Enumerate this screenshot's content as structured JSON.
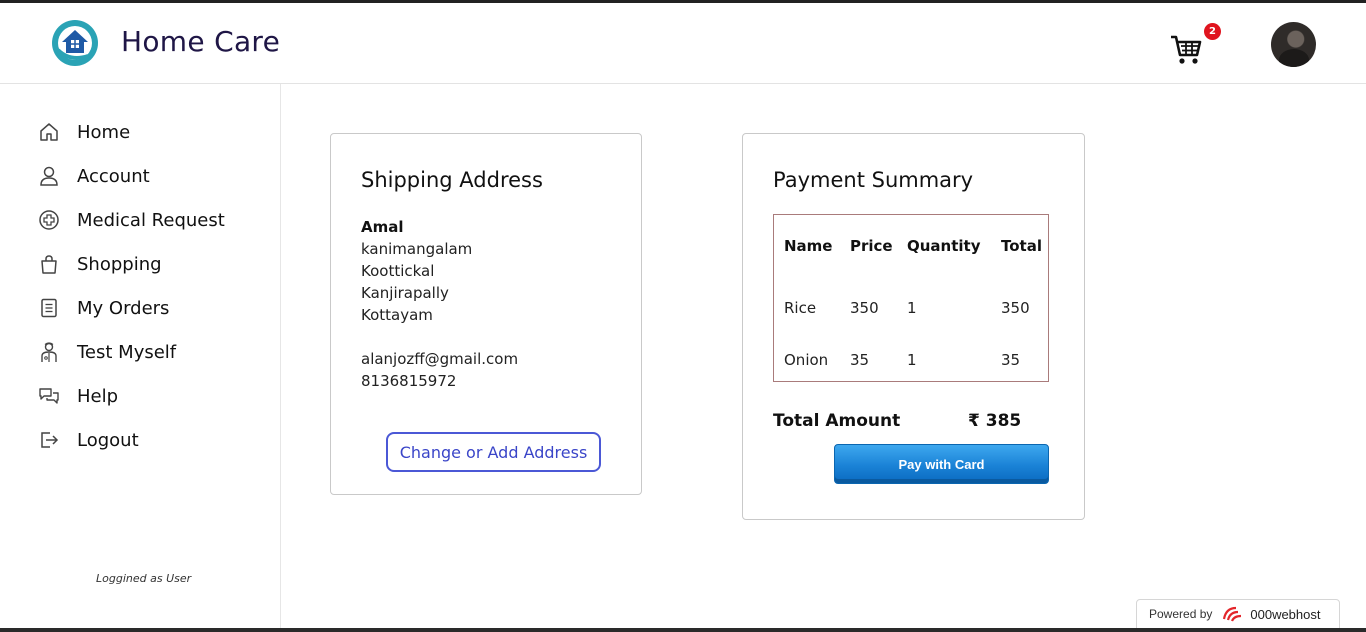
{
  "header": {
    "brand": "Home Care",
    "cart_count": "2",
    "logo_icon": "home-hand-logo-icon",
    "cart_icon": "cart-icon"
  },
  "sidebar": {
    "items": [
      {
        "label": "Home",
        "icon": "home-icon"
      },
      {
        "label": "Account",
        "icon": "user-icon"
      },
      {
        "label": "Medical Request",
        "icon": "medical-cross-icon"
      },
      {
        "label": "Shopping",
        "icon": "shopping-bag-icon"
      },
      {
        "label": "My Orders",
        "icon": "orders-list-icon"
      },
      {
        "label": "Test Myself",
        "icon": "doctor-icon"
      },
      {
        "label": "Help",
        "icon": "chat-bubbles-icon"
      },
      {
        "label": "Logout",
        "icon": "logout-icon"
      }
    ],
    "logged_as": "Loggined as User"
  },
  "shipping": {
    "title": "Shipping Address",
    "name": "Amal",
    "lines": [
      "kanimangalam",
      "Koottickal",
      "Kanjirapally",
      "Kottayam"
    ],
    "email": "alanjozff@gmail.com",
    "phone": "8136815972",
    "change_button": "Change or Add Address"
  },
  "payment": {
    "title": "Payment Summary",
    "headers": [
      "Name",
      "Price",
      "Quantity",
      "Total"
    ],
    "rows": [
      [
        "Rice",
        "350",
        "1",
        "350"
      ],
      [
        "Onion",
        "35",
        "1",
        "35"
      ]
    ],
    "total_label": "Total Amount",
    "total_value": "₹ 385",
    "pay_button": "Pay with Card"
  },
  "footer": {
    "powered_by": "Powered by",
    "host": "000webhost"
  },
  "colors": {
    "brand_text": "#1f1646",
    "logo_teal": "#2aa3b5",
    "badge_red": "#e0141e",
    "change_button_border": "#4b58d6",
    "pay_button_blue": "#1a82d6"
  }
}
